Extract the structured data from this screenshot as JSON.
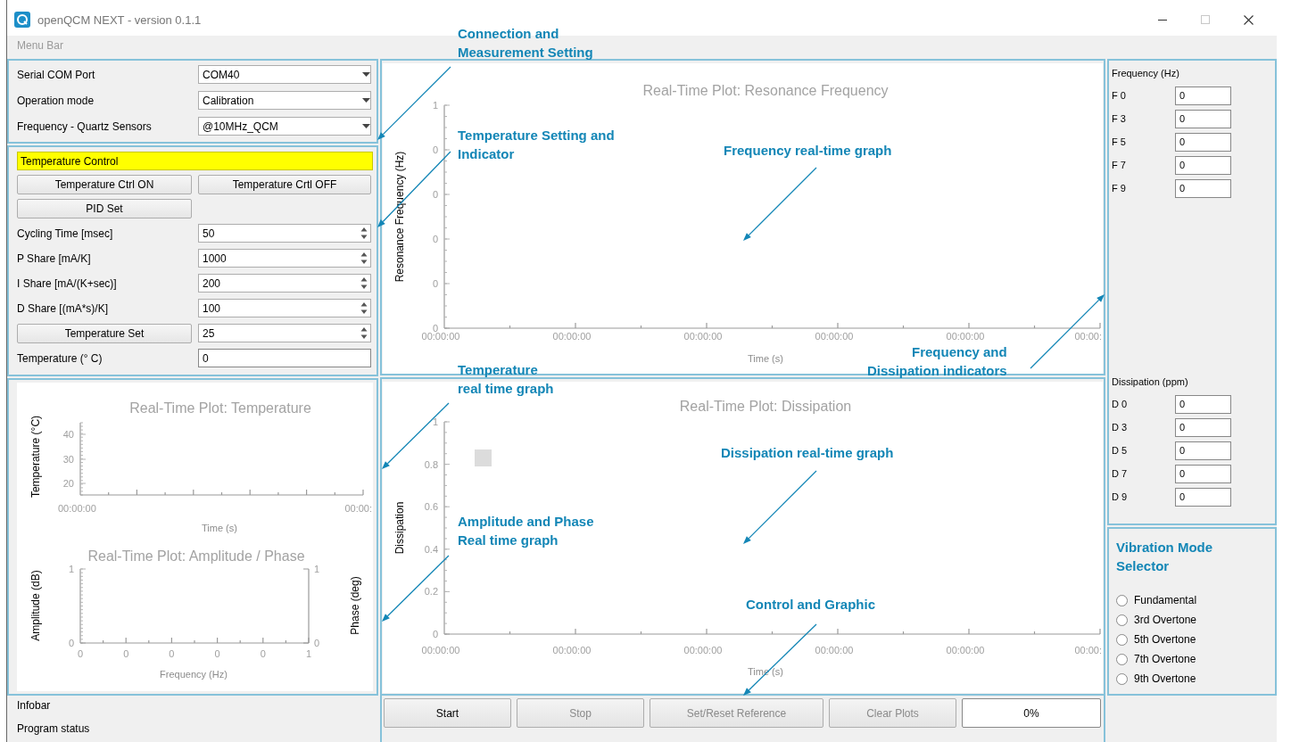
{
  "window": {
    "title": "openQCM NEXT - version 0.1.1"
  },
  "menu_bar": {
    "label": "Menu Bar"
  },
  "connection": {
    "fields": [
      {
        "label": "Serial COM Port",
        "value": "COM40"
      },
      {
        "label": "Operation mode",
        "value": "Calibration"
      },
      {
        "label": "Frequency - Quartz Sensors",
        "value": "@10MHz_QCM"
      }
    ]
  },
  "temperature": {
    "status": "Temperature Control",
    "buttons": [
      "Temperature Ctrl ON",
      "Temperature Crtl OFF"
    ],
    "pid_button": "PID Set",
    "rows": [
      {
        "kind": "spin",
        "label": "Cycling Time [msec]",
        "value": "50"
      },
      {
        "kind": "spin",
        "label": "P Share [mA/K]",
        "value": "1000"
      },
      {
        "kind": "spin",
        "label": "I Share [mA/(K+sec)]",
        "value": "200"
      },
      {
        "kind": "spin",
        "label": "D Share [(mA*s)/K]",
        "value": "100"
      },
      {
        "kind": "button",
        "label": "Temperature Set",
        "value": "25"
      },
      {
        "kind": "readout",
        "label": "Temperature (° C)",
        "value": "0"
      }
    ]
  },
  "plots": [
    {
      "kind": "temperature",
      "title": "Real-Time Plot: Temperature",
      "ylabel": "Temperature (°C)",
      "xlabel": "Time (s)",
      "yticks": [
        "40",
        "30",
        "20"
      ],
      "xticks": [
        "00:00:00",
        "00:00:"
      ]
    },
    {
      "kind": "amplitude",
      "title": "Real-Time Plot: Amplitude / Phase",
      "ylabel": "Amplitude (dB)",
      "y2label": "Phase (deg)",
      "xlabel": "Frequency (Hz)",
      "yticks": [
        "1",
        "0"
      ],
      "y2ticks": [
        "1",
        "0"
      ],
      "xticks": [
        "0",
        "0",
        "0",
        "0",
        "0",
        "1"
      ]
    },
    {
      "kind": "frequency",
      "title": "Real-Time Plot: Resonance Frequency",
      "ylabel": "Resonance Frequency (Hz)",
      "xlabel": "Time (s)",
      "yticks": [
        "1",
        "0",
        "0",
        "0",
        "0",
        "0"
      ],
      "xticks": [
        "00:00:00",
        "00:00:00",
        "00:00:00",
        "00:00:00",
        "00:00:00",
        "00:00:"
      ]
    },
    {
      "kind": "dissipation",
      "title": "Real-Time Plot: Dissipation",
      "ylabel": "Dissipation",
      "xlabel": "Time (s)",
      "yticks": [
        "1",
        "0.8",
        "0.6",
        "0.4",
        "0.2",
        "0"
      ],
      "xticks": [
        "00:00:00",
        "00:00:00",
        "00:00:00",
        "00:00:00",
        "00:00:00",
        "00:00:"
      ]
    }
  ],
  "indicators": {
    "frequency": {
      "title": "Frequency (Hz)",
      "items": [
        {
          "label": "F 0",
          "value": "0"
        },
        {
          "label": "F 3",
          "value": "0"
        },
        {
          "label": "F 5",
          "value": "0"
        },
        {
          "label": "F 7",
          "value": "0"
        },
        {
          "label": "F 9",
          "value": "0"
        }
      ]
    },
    "dissipation": {
      "title": "Dissipation (ppm)",
      "items": [
        {
          "label": "D 0",
          "value": "0"
        },
        {
          "label": "D 3",
          "value": "0"
        },
        {
          "label": "D 5",
          "value": "0"
        },
        {
          "label": "D 7",
          "value": "0"
        },
        {
          "label": "D 9",
          "value": "0"
        }
      ]
    }
  },
  "vibration_mode": {
    "title": "Vibration Mode\nSelector",
    "options": [
      {
        "label": "Fundamental",
        "selected": false
      },
      {
        "label": "3rd Overtone",
        "selected": false
      },
      {
        "label": "5th Overtone",
        "selected": false
      },
      {
        "label": "7th Overtone",
        "selected": false
      },
      {
        "label": "9th Overtone",
        "selected": false
      }
    ]
  },
  "infobar": {
    "title": "Infobar",
    "status": "Program status"
  },
  "controls": {
    "buttons": [
      {
        "label": "Start",
        "disabled": false
      },
      {
        "label": "Stop",
        "disabled": true
      },
      {
        "label": "Set/Reset Reference",
        "disabled": true
      },
      {
        "label": "Clear Plots",
        "disabled": true
      }
    ],
    "progress": {
      "level": 0,
      "text": "0%"
    }
  },
  "annotations": [
    {
      "text": "Connection and\nMeasurement Setting"
    },
    {
      "text": "Temperature Setting and\nIndicator"
    },
    {
      "text": "Frequency real-time graph"
    },
    {
      "text": "Frequency and\nDissipation indicators"
    },
    {
      "text": "Temperature\nreal time graph"
    },
    {
      "text": "Dissipation real-time graph"
    },
    {
      "text": "Amplitude and Phase\nReal time graph"
    },
    {
      "text": "Control and Graphic"
    }
  ]
}
